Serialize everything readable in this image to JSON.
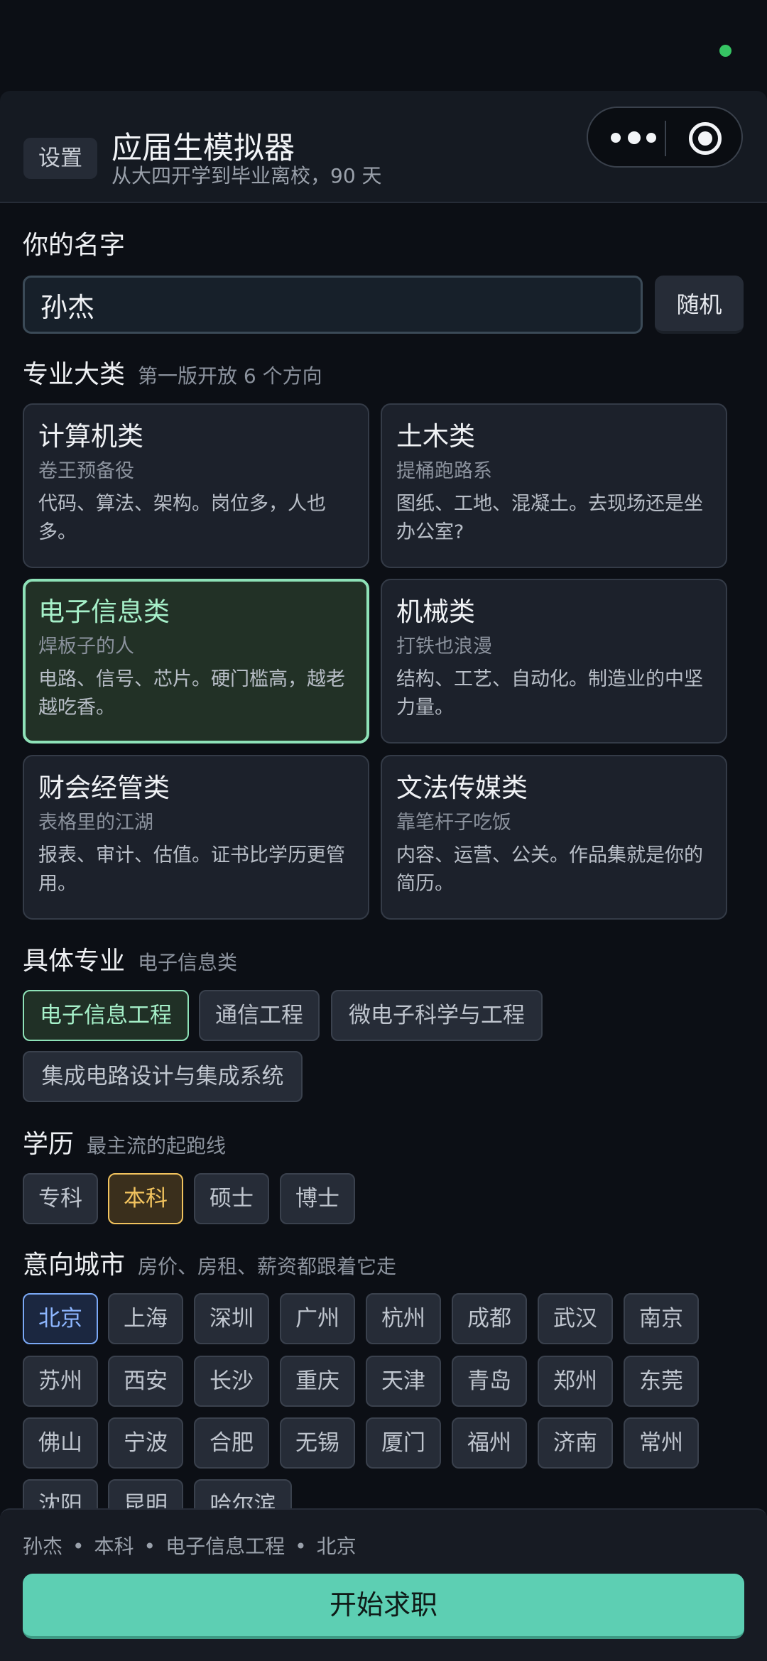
{
  "header": {
    "settings_label": "设置",
    "title": "应届生模拟器",
    "subtitle": "从大四开学到毕业离校，90 天"
  },
  "name_section": {
    "title": "你的名字",
    "value": "孙杰",
    "random_label": "随机"
  },
  "category_section": {
    "title": "专业大类",
    "note": "第一版开放 6 个方向",
    "cards": [
      {
        "name": "计算机类",
        "tag": "卷王预备役",
        "desc": " 代码、算法、架构。岗位多，人也多。"
      },
      {
        "name": "土木类",
        "tag": "提桶跑路系",
        "desc": "图纸、工地、混凝土。去现场还是坐办公室?"
      },
      {
        "name": "电子信息类",
        "tag": "焊板子的人",
        "desc": "电路、信号、芯片。硬门槛高，越老越吃香。"
      },
      {
        "name": "机械类",
        "tag": "打铁也浪漫",
        "desc": "结构、工艺、自动化。制造业的中坚力量。"
      },
      {
        "name": "财会经管类",
        "tag": "表格里的江湖",
        "desc": " 报表、审计、估值。证书比学历更管用。"
      },
      {
        "name": "文法传媒类",
        "tag": "靠笔杆子吃饭",
        "desc": "内容、运营、公关。作品集就是你的简历。"
      }
    ],
    "selected_index": 2
  },
  "major_section": {
    "title": "具体专业",
    "note": "电子信息类",
    "options": [
      "电子信息工程",
      "通信工程",
      "微电子科学与工程",
      "集成电路设计与集成系统"
    ]
  },
  "degree_section": {
    "title": "学历",
    "note": "最主流的起跑线",
    "options": [
      "专科",
      "本科",
      "硕士",
      "博士"
    ]
  },
  "city_section": {
    "title": "意向城市",
    "note": "房价、房租、薪资都跟着它走",
    "options": [
      "北京",
      "上海",
      "深圳",
      "广州",
      "杭州",
      "成都",
      "武汉",
      "南京",
      "苏州",
      "西安",
      "长沙",
      "重庆",
      "天津",
      "青岛",
      "郑州",
      "东莞",
      "佛山",
      "宁波",
      "合肥",
      "无锡",
      "厦门",
      "福州",
      "济南",
      "常州",
      "沈阳",
      "昆明",
      "哈尔滨"
    ]
  },
  "footer": {
    "summary": [
      "孙杰",
      "本科",
      "电子信息工程",
      "北京"
    ],
    "separator": "•",
    "start_label": "开始求职"
  },
  "colors": {
    "background": "#0c0f15",
    "accent_green": "#8ee2b8",
    "accent_gold": "#f1c35e",
    "accent_blue": "#7aa8f5",
    "start_button": "#5dcfb3"
  }
}
